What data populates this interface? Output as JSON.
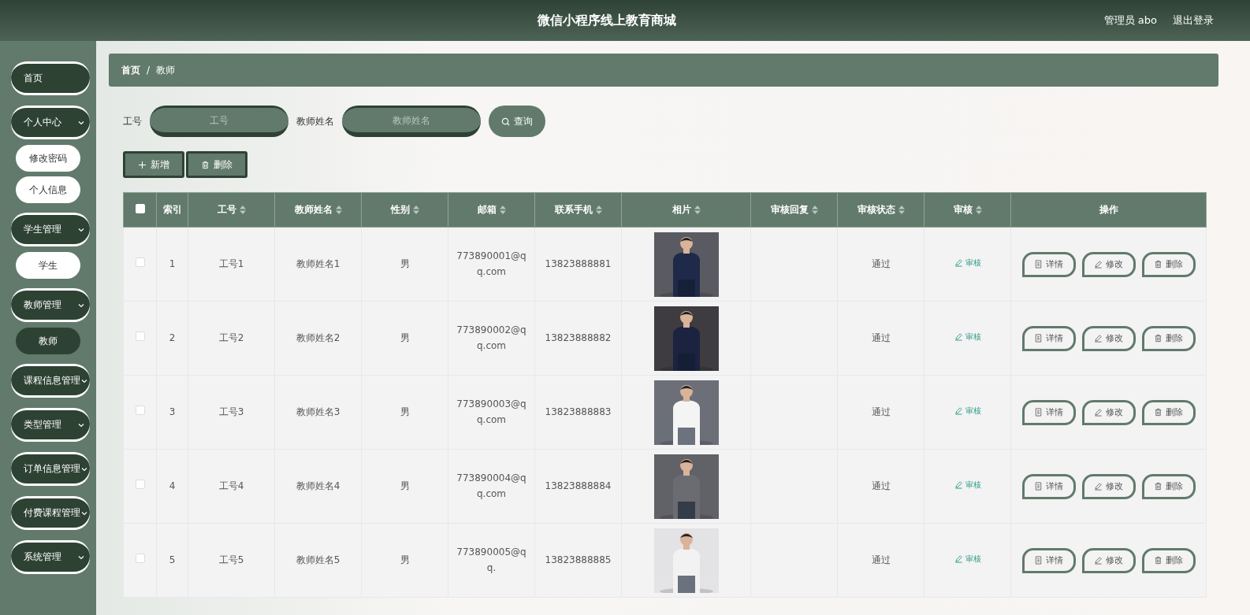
{
  "header": {
    "title": "微信小程序线上教育商城",
    "user": "管理员 abo",
    "logout": "退出登录"
  },
  "sidebar": {
    "items": [
      {
        "label": "首页",
        "kind": "link"
      },
      {
        "label": "个人中心",
        "kind": "group",
        "children": [
          {
            "label": "修改密码",
            "selected": false
          },
          {
            "label": "个人信息",
            "selected": false
          }
        ]
      },
      {
        "label": "学生管理",
        "kind": "group",
        "children": [
          {
            "label": "学生",
            "selected": false
          }
        ]
      },
      {
        "label": "教师管理",
        "kind": "group",
        "children": [
          {
            "label": "教师",
            "selected": true
          }
        ]
      },
      {
        "label": "课程信息管理",
        "kind": "group"
      },
      {
        "label": "类型管理",
        "kind": "group"
      },
      {
        "label": "订单信息管理",
        "kind": "group"
      },
      {
        "label": "付费课程管理",
        "kind": "group"
      },
      {
        "label": "系统管理",
        "kind": "group"
      }
    ]
  },
  "breadcrumb": [
    "首页",
    "/",
    "教师"
  ],
  "search": {
    "fields": [
      {
        "label": "工号",
        "placeholder": "工号"
      },
      {
        "label": "教师姓名",
        "placeholder": "教师姓名"
      }
    ],
    "button": "查询"
  },
  "toolbar": [
    {
      "label": "新增",
      "kind": "add"
    },
    {
      "label": "删除",
      "kind": "delete"
    }
  ],
  "table": {
    "all_checked": false,
    "columns": [
      {
        "label": "索引",
        "sortable": false
      },
      {
        "label": "工号",
        "sortable": true
      },
      {
        "label": "教师姓名",
        "sortable": true
      },
      {
        "label": "性别",
        "sortable": true
      },
      {
        "label": "邮箱",
        "sortable": true
      },
      {
        "label": "联系手机",
        "sortable": true
      },
      {
        "label": "相片",
        "sortable": true
      },
      {
        "label": "审核回复",
        "sortable": true
      },
      {
        "label": "审核状态",
        "sortable": true
      },
      {
        "label": "审核",
        "sortable": true
      },
      {
        "label": "操作",
        "sortable": false
      }
    ],
    "rows": [
      {
        "checked": false,
        "index": "1",
        "id": "工号1",
        "name": "教师姓名1",
        "gender": "男",
        "email": "773890001@qq.com",
        "phone": "13823888881",
        "status": "通过",
        "review": "审核",
        "actions": [
          {
            "label": "详情",
            "kind": "detail"
          },
          {
            "label": "修改",
            "kind": "edit"
          },
          {
            "label": "删除",
            "kind": "delete"
          }
        ]
      },
      {
        "checked": false,
        "index": "2",
        "id": "工号2",
        "name": "教师姓名2",
        "gender": "男",
        "email": "773890002@qq.com",
        "phone": "13823888882",
        "status": "通过",
        "review": "审核",
        "actions": [
          {
            "label": "详情",
            "kind": "detail"
          },
          {
            "label": "修改",
            "kind": "edit"
          },
          {
            "label": "删除",
            "kind": "delete"
          }
        ]
      },
      {
        "checked": false,
        "index": "3",
        "id": "工号3",
        "name": "教师姓名3",
        "gender": "男",
        "email": "773890003@qq.com",
        "phone": "13823888883",
        "status": "通过",
        "review": "审核",
        "actions": [
          {
            "label": "详情",
            "kind": "detail"
          },
          {
            "label": "修改",
            "kind": "edit"
          },
          {
            "label": "删除",
            "kind": "delete"
          }
        ]
      },
      {
        "checked": false,
        "index": "4",
        "id": "工号4",
        "name": "教师姓名4",
        "gender": "男",
        "email": "773890004@qq.com",
        "phone": "13823888884",
        "status": "通过",
        "review": "审核",
        "actions": [
          {
            "label": "详情",
            "kind": "detail"
          },
          {
            "label": "修改",
            "kind": "edit"
          },
          {
            "label": "删除",
            "kind": "delete"
          }
        ]
      },
      {
        "checked": false,
        "index": "5",
        "id": "工号5",
        "name": "教师姓名5",
        "gender": "男",
        "email": "773890005@qq.",
        "phone": "13823888885",
        "status": "通过",
        "review": "审核",
        "actions": [
          {
            "label": "详情",
            "kind": "detail"
          },
          {
            "label": "修改",
            "kind": "edit"
          },
          {
            "label": "删除",
            "kind": "delete"
          }
        ]
      }
    ]
  }
}
